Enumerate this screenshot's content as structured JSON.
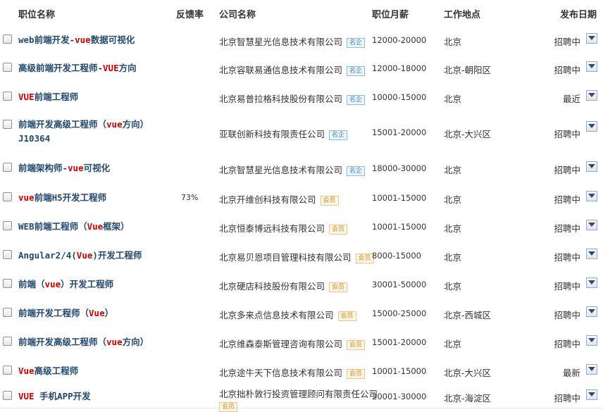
{
  "columns": {
    "title": "职位名称",
    "feedback": "反馈率",
    "company": "公司名称",
    "salary": "职位月薪",
    "location": "工作地点",
    "date": "发布日期"
  },
  "rows": [
    {
      "title_parts": [
        {
          "t": "web前端开发-",
          "hl": false
        },
        {
          "t": "vue",
          "hl": true
        },
        {
          "t": "数据可视化",
          "hl": false
        }
      ],
      "title_line2": "",
      "rate": "",
      "company": "北京智慧星光信息技术有限公司",
      "badge": "名企",
      "badge_color": "blue",
      "salary": "12000-20000",
      "location": "北京",
      "status": "招聘中"
    },
    {
      "title_parts": [
        {
          "t": "高级前端开发工程师-",
          "hl": false
        },
        {
          "t": "VUE",
          "hl": true
        },
        {
          "t": "方向",
          "hl": false
        }
      ],
      "title_line2": "",
      "rate": "",
      "company": "北京容联易通信息技术有限公司",
      "badge": "名企",
      "badge_color": "blue",
      "salary": "12000-18000",
      "location": "北京-朝阳区",
      "status": "招聘中"
    },
    {
      "title_parts": [
        {
          "t": "VUE",
          "hl": true
        },
        {
          "t": "前端工程师",
          "hl": false
        }
      ],
      "title_line2": "",
      "rate": "",
      "company": "北京易普拉格科技股份有限公司",
      "badge": "名企",
      "badge_color": "blue",
      "salary": "10000-15000",
      "location": "北京",
      "status": "最近"
    },
    {
      "title_parts": [
        {
          "t": "前端开发高级工程师（",
          "hl": false
        },
        {
          "t": "vue",
          "hl": true
        },
        {
          "t": "方向）",
          "hl": false
        }
      ],
      "title_line2": "J10364",
      "rate": "",
      "company": "亚联创新科技有限责任公司",
      "badge": "名企",
      "badge_color": "blue",
      "salary": "15001-20000",
      "location": "北京-大兴区",
      "status": "招聘中"
    },
    {
      "title_parts": [
        {
          "t": "前端架构师-",
          "hl": false
        },
        {
          "t": "vue",
          "hl": true
        },
        {
          "t": "可视化",
          "hl": false
        }
      ],
      "title_line2": "",
      "rate": "",
      "company": "北京智慧星光信息技术有限公司",
      "badge": "名企",
      "badge_color": "blue",
      "salary": "18000-30000",
      "location": "北京",
      "status": "招聘中"
    },
    {
      "title_parts": [
        {
          "t": "vue",
          "hl": true
        },
        {
          "t": "前端H5开发工程师",
          "hl": false
        }
      ],
      "title_line2": "",
      "rate": "73%",
      "company": "北京开维创科技有限公司",
      "badge": "会员",
      "badge_color": "orange",
      "salary": "10001-15000",
      "location": "北京",
      "status": "招聘中"
    },
    {
      "title_parts": [
        {
          "t": "WEB前端工程师（",
          "hl": false
        },
        {
          "t": "Vue",
          "hl": true
        },
        {
          "t": "框架）",
          "hl": false
        }
      ],
      "title_line2": "",
      "rate": "",
      "company": "北京恒泰博远科技有限公司",
      "badge": "会员",
      "badge_color": "orange",
      "salary": "10001-15000",
      "location": "北京",
      "status": "招聘中"
    },
    {
      "title_parts": [
        {
          "t": "Angular2/4(",
          "hl": false
        },
        {
          "t": "Vue",
          "hl": true
        },
        {
          "t": ")开发工程师",
          "hl": false
        }
      ],
      "title_line2": "",
      "rate": "",
      "company": "北京易贝恩项目管理科技有限公司",
      "badge": "会员",
      "badge_color": "orange",
      "salary": "8000-15000",
      "location": "北京",
      "status": "招聘中"
    },
    {
      "title_parts": [
        {
          "t": "前端（",
          "hl": false
        },
        {
          "t": "vue",
          "hl": true
        },
        {
          "t": "）开发工程师",
          "hl": false
        }
      ],
      "title_line2": "",
      "rate": "",
      "company": "北京硬店科技股份有限公司",
      "badge": "会员",
      "badge_color": "orange",
      "salary": "30001-50000",
      "location": "北京",
      "status": "招聘中"
    },
    {
      "title_parts": [
        {
          "t": "前端开发工程师（",
          "hl": false
        },
        {
          "t": "Vue",
          "hl": true
        },
        {
          "t": "）",
          "hl": false
        }
      ],
      "title_line2": "",
      "rate": "",
      "company": "北京多来点信息技术有限公司",
      "badge": "会员",
      "badge_color": "orange",
      "salary": "15000-25000",
      "location": "北京-西城区",
      "status": "招聘中"
    },
    {
      "title_parts": [
        {
          "t": "前端开发高级工程师（",
          "hl": false
        },
        {
          "t": "vue",
          "hl": true
        },
        {
          "t": "方向）",
          "hl": false
        }
      ],
      "title_line2": "",
      "rate": "",
      "company": "北京维森泰斯管理咨询有限公司",
      "badge": "会员",
      "badge_color": "orange",
      "salary": "15001-20000",
      "location": "北京",
      "status": "招聘中"
    },
    {
      "title_parts": [
        {
          "t": "Vue",
          "hl": true
        },
        {
          "t": "高级工程师",
          "hl": false
        }
      ],
      "title_line2": "",
      "rate": "",
      "company": "北京途牛天下信息技术有限公司",
      "badge": "会员",
      "badge_color": "orange",
      "salary": "10001-15000",
      "location": "北京-大兴区",
      "status": "最新"
    },
    {
      "title_parts": [
        {
          "t": "VUE",
          "hl": true
        },
        {
          "t": " 手机APP开发",
          "hl": false
        }
      ],
      "title_line2": "",
      "rate": "",
      "company": "北京拙朴敦行投资管理顾问有限责任公司",
      "badge": "会员",
      "badge_color": "orange",
      "salary": "20001-30000",
      "location": "北京-海淀区",
      "status": "招聘中"
    }
  ]
}
